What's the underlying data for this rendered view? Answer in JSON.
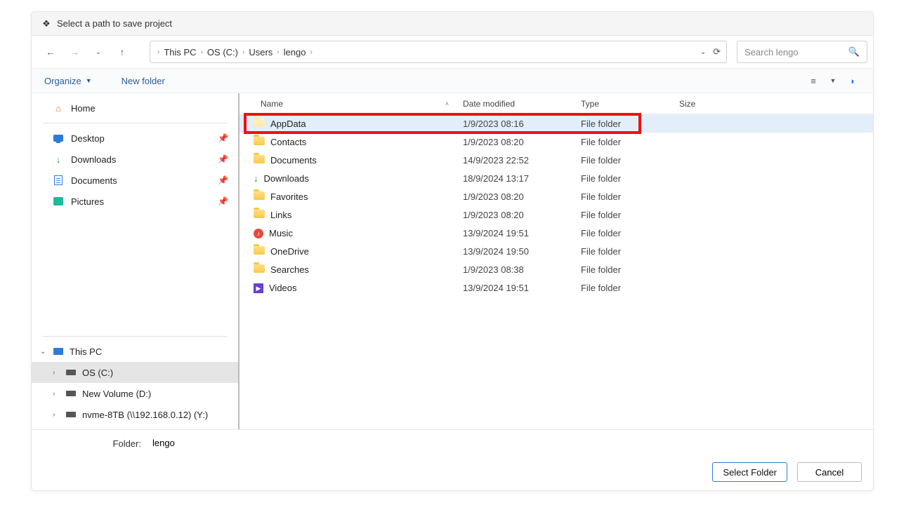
{
  "title": "Select a path to save project",
  "breadcrumb": [
    "This PC",
    "OS (C:)",
    "Users",
    "lengo"
  ],
  "search_placeholder": "Search lengo",
  "toolbar": {
    "organize": "Organize",
    "new_folder": "New folder"
  },
  "sidebar": {
    "home": "Home",
    "quick": [
      {
        "name": "Desktop",
        "icon": "desktop"
      },
      {
        "name": "Downloads",
        "icon": "download"
      },
      {
        "name": "Documents",
        "icon": "docs"
      },
      {
        "name": "Pictures",
        "icon": "pics"
      }
    ],
    "tree": [
      {
        "name": "This PC",
        "expanded": true,
        "icon": "pc",
        "children": [
          {
            "name": "OS (C:)",
            "selected": true,
            "icon": "drive"
          },
          {
            "name": "New Volume (D:)",
            "icon": "drive"
          },
          {
            "name": "nvme-8TB (\\\\192.168.0.12) (Y:)",
            "icon": "drive"
          }
        ]
      }
    ]
  },
  "columns": {
    "name": "Name",
    "date": "Date modified",
    "type": "Type",
    "size": "Size"
  },
  "rows": [
    {
      "name": "AppData",
      "date": "1/9/2023 08:16",
      "type": "File folder",
      "icon": "folder-pale",
      "selected": true
    },
    {
      "name": "Contacts",
      "date": "1/9/2023 08:20",
      "type": "File folder",
      "icon": "folder"
    },
    {
      "name": "Documents",
      "date": "14/9/2023 22:52",
      "type": "File folder",
      "icon": "folder"
    },
    {
      "name": "Downloads",
      "date": "18/9/2024 13:17",
      "type": "File folder",
      "icon": "download"
    },
    {
      "name": "Favorites",
      "date": "1/9/2023 08:20",
      "type": "File folder",
      "icon": "folder"
    },
    {
      "name": "Links",
      "date": "1/9/2023 08:20",
      "type": "File folder",
      "icon": "folder"
    },
    {
      "name": "Music",
      "date": "13/9/2024 19:51",
      "type": "File folder",
      "icon": "music"
    },
    {
      "name": "OneDrive",
      "date": "13/9/2024 19:50",
      "type": "File folder",
      "icon": "folder"
    },
    {
      "name": "Searches",
      "date": "1/9/2023 08:38",
      "type": "File folder",
      "icon": "folder"
    },
    {
      "name": "Videos",
      "date": "13/9/2024 19:51",
      "type": "File folder",
      "icon": "video"
    }
  ],
  "highlight_row_index": 0,
  "folder_label": "Folder:",
  "folder_value": "lengo",
  "buttons": {
    "select": "Select Folder",
    "cancel": "Cancel"
  }
}
